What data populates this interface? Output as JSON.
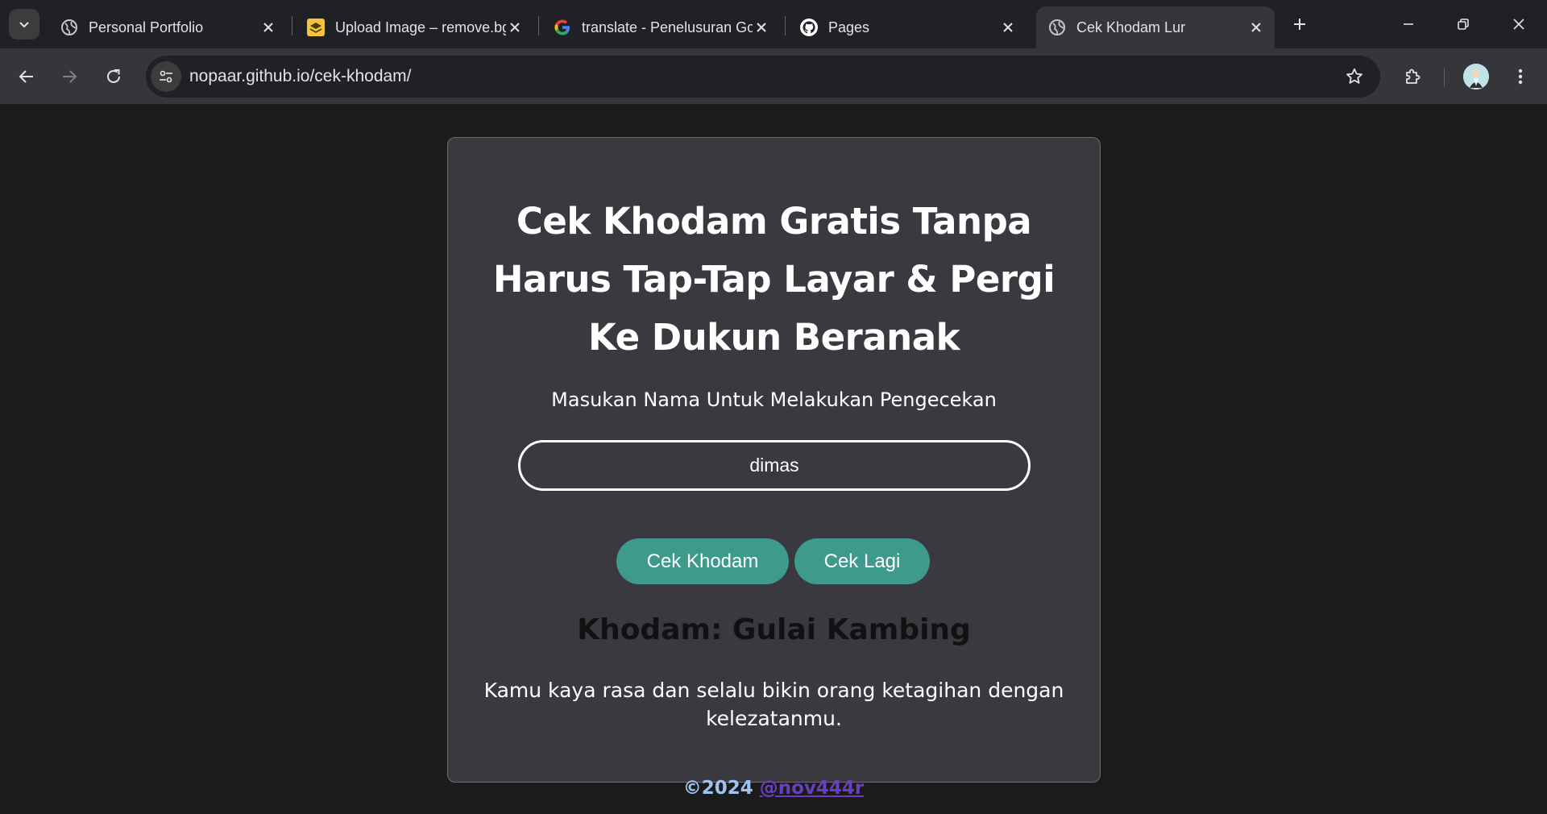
{
  "browser": {
    "tabs": [
      {
        "title": "Personal Portfolio",
        "icon": "globe-icon",
        "active": false
      },
      {
        "title": "Upload Image – remove.bg",
        "icon": "removebg-icon",
        "active": false
      },
      {
        "title": "translate - Penelusuran Google",
        "icon": "google-icon",
        "active": false
      },
      {
        "title": "Pages",
        "icon": "github-icon",
        "active": false
      },
      {
        "title": "Cek Khodam Lur",
        "icon": "globe-icon",
        "active": true
      }
    ],
    "url": "nopaar.github.io/cek-khodam/"
  },
  "page": {
    "heading_lines": [
      "Cek Khodam Gratis Tanpa",
      "Harus Tap-Tap Layar & Pergi",
      "Ke Dukun Beranak"
    ],
    "prompt": "Masukan Nama Untuk Melakukan Pengecekan",
    "name_input_value": "dimas",
    "buttons": {
      "check": "Cek Khodam",
      "again": "Cek Lagi"
    },
    "result_title": "Khodam: Gulai Kambing",
    "result_description": "Kamu kaya rasa dan selalu bikin orang ketagihan dengan kelezatanmu.",
    "footer": {
      "copyright": "©2024",
      "author": "@nov444r"
    }
  },
  "colors": {
    "page_bg": "#1b1b1b",
    "card_bg": "#39393f",
    "button_teal": "#3e9a8d",
    "footer_link": "#6a3fbf",
    "footer_copy": "#9ec2f0"
  }
}
